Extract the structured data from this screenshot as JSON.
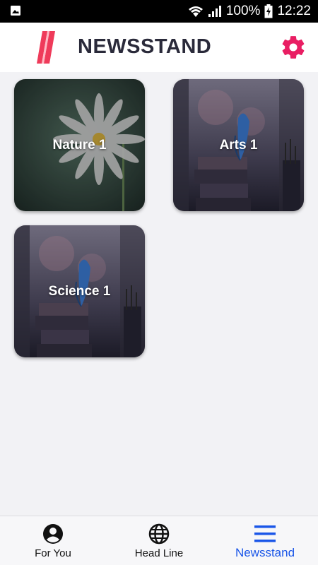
{
  "status_bar": {
    "battery": "100%",
    "time": "12:22",
    "icons": [
      "image-icon",
      "wifi-icon",
      "signal-icon",
      "battery-charging-icon"
    ]
  },
  "app_bar": {
    "title": "NEWSSTAND",
    "logo_icon": "newsstand-logo-icon",
    "settings_icon": "gear-icon",
    "accent_color": "#e91e63"
  },
  "categories": [
    {
      "label": "Nature 1",
      "image": "daisy-flower"
    },
    {
      "label": "Arts 1",
      "image": "butterfly-on-books"
    },
    {
      "label": "Science 1",
      "image": "butterfly-on-books"
    }
  ],
  "bottom_nav": {
    "items": [
      {
        "label": "For You",
        "icon": "person-circle-icon",
        "active": false
      },
      {
        "label": "Head Line",
        "icon": "globe-icon",
        "active": false
      },
      {
        "label": "Newsstand",
        "icon": "menu-lines-icon",
        "active": true
      }
    ],
    "active_color": "#1a56e8"
  }
}
